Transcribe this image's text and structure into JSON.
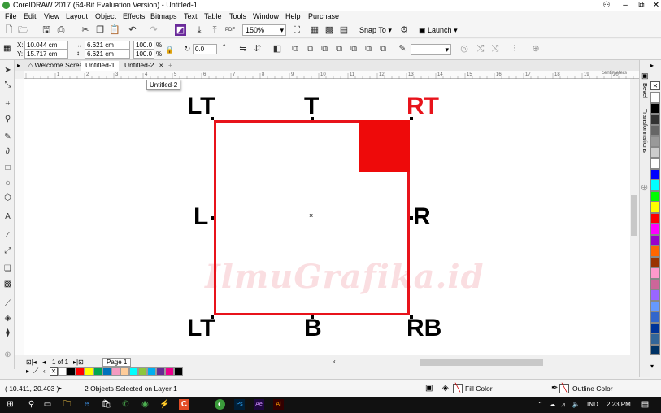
{
  "window": {
    "title": "CorelDRAW 2017 (64-Bit Evaluation Version) - Untitled-1",
    "minimize": "‒",
    "maximize": "⧉",
    "close": "✕"
  },
  "menu": [
    "File",
    "Edit",
    "View",
    "Layout",
    "Object",
    "Effects",
    "Bitmaps",
    "Text",
    "Table",
    "Tools",
    "Window",
    "Help",
    "Purchase"
  ],
  "standard_toolbar": {
    "zoom_value": "150%",
    "snap_to_label": "Snap To",
    "launch_label": "Launch",
    "pdf_label": "PDF"
  },
  "property_bar": {
    "x_label": "X:",
    "x_value": "10.044 cm",
    "y_label": "Y:",
    "y_value": "15.717 cm",
    "w_value": "6.621 cm",
    "h_value": "6.621 cm",
    "scale_w": "100.0",
    "scale_h": "100.0",
    "percent": "%",
    "rotation_value": "0.0",
    "degree": "°"
  },
  "tabs": {
    "welcome": "Welcome Screen",
    "untitled1": "Untitled-1",
    "untitled2": "Untitled-2",
    "close": "×",
    "add": "+"
  },
  "tooltip": "Untitled-2",
  "ruler": {
    "ticks": [
      "1",
      "2",
      "3",
      "4",
      "5",
      "6",
      "7",
      "8",
      "9",
      "10",
      "11",
      "12",
      "13",
      "14",
      "15",
      "16",
      "17",
      "18",
      "19",
      "20"
    ],
    "units": "centimeters"
  },
  "canvas": {
    "labels": {
      "lt_top": "LT",
      "t": "T",
      "rt": "RT",
      "l": "L",
      "r": "R",
      "lt_bottom": "LT",
      "b": "B",
      "rb": "RB"
    },
    "watermark": "IlmuGrafika.id",
    "colors": {
      "outline": "#e8131b",
      "fill_square": "#ee0a0a",
      "rt_label": "#e8131b"
    }
  },
  "page_nav": {
    "page_count": "1 of 1",
    "page_tab": "Page 1"
  },
  "palette": [
    "#ffffff",
    "#000000",
    "#ff0000",
    "#ffff00",
    "#00a651",
    "#0072bc",
    "#f49ac1",
    "#ffcc99",
    "#00ffff",
    "#8dc63f",
    "#00aeef",
    "#662d91",
    "#ec008c",
    "#000000"
  ],
  "right_palette": [
    "#ffffff",
    "#000000",
    "#333333",
    "#666666",
    "#999999",
    "#cccccc",
    "#ffffff",
    "#0000ff",
    "#00ffff",
    "#00ff00",
    "#ffff00",
    "#ff0000",
    "#ff00ff",
    "#9900cc",
    "#ff6600",
    "#993300",
    "#ff99cc",
    "#cc6699",
    "#9966ff",
    "#6699ff",
    "#3366cc",
    "#003399",
    "#336699",
    "#003366"
  ],
  "right_panel": {
    "bevel": "Bevel",
    "transformations": "Transformations"
  },
  "status": {
    "coords": "( 10.411, 20.403 )",
    "selection": "2 Objects Selected on Layer 1",
    "fill_label": "Fill Color",
    "outline_label": "Outline Color"
  },
  "taskbar": {
    "lang": "IND",
    "time": "2:23 PM",
    "app_ps": "Ps",
    "app_ae": "Ae",
    "app_ai": "Ai",
    "app_c": "C"
  }
}
